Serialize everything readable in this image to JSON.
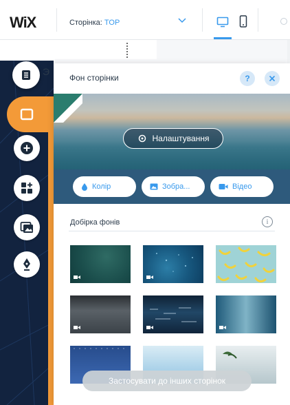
{
  "topbar": {
    "logo": "WiX",
    "page_label": "Сторінка:",
    "page_value": "TOP"
  },
  "leftbar": {
    "items": [
      {
        "name": "pages",
        "icon": "pages-icon"
      },
      {
        "name": "background",
        "icon": "background-icon",
        "active": true
      },
      {
        "name": "add",
        "icon": "plus-icon"
      },
      {
        "name": "apps",
        "icon": "apps-icon"
      },
      {
        "name": "media",
        "icon": "media-icon"
      },
      {
        "name": "blog",
        "icon": "pen-nib-icon"
      }
    ],
    "pages_glyph": "Э"
  },
  "panel": {
    "title": "Фон сторінки",
    "help": "?",
    "settings_label": "Налаштування",
    "type_buttons": {
      "color": "Колір",
      "image": "Зобра...",
      "video": "Відео"
    },
    "section_title": "Добірка фонів",
    "info": "i",
    "apply_label": "Застосувати до інших сторінок"
  },
  "colors": {
    "accent": "#3899ec",
    "sidebar": "#12233f",
    "active_tab": "#f39a38"
  }
}
